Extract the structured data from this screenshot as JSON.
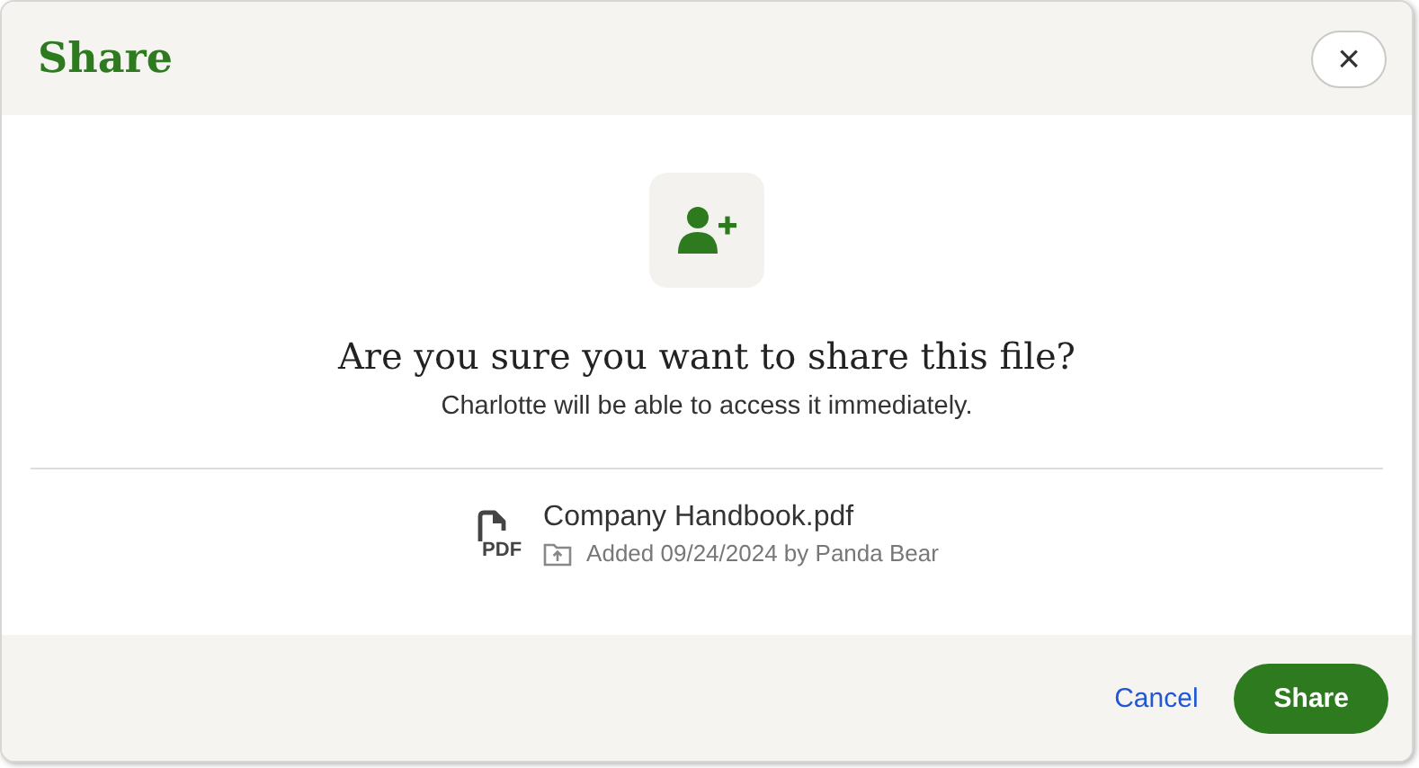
{
  "dialog": {
    "title": "Share",
    "close": "×"
  },
  "heading": "Are you sure you want to share this file?",
  "message": "Charlotte will be able to access it immediately.",
  "file": {
    "type_label": "PDF",
    "name": "Company Handbook.pdf",
    "meta": "Added 09/24/2024 by Panda Bear"
  },
  "buttons": [
    {
      "kind": "link",
      "label": "Cancel"
    },
    {
      "kind": "primary",
      "label": "Share"
    }
  ]
}
